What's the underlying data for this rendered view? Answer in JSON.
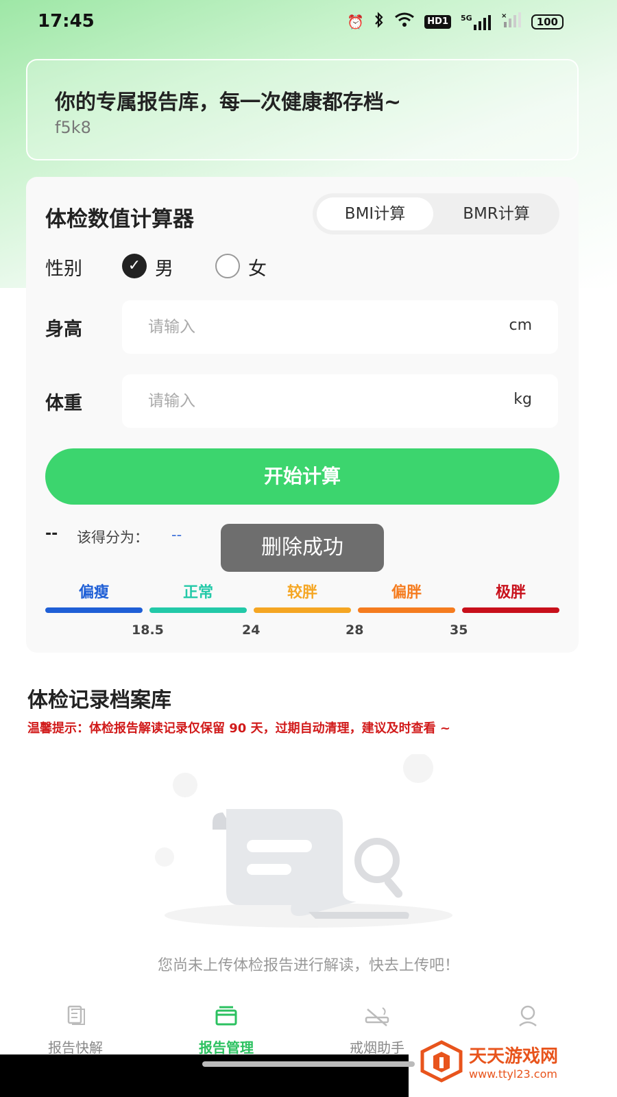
{
  "status_bar": {
    "time": "17:45",
    "network": "5G",
    "hd_badge": "HD1",
    "battery": "100"
  },
  "banner": {
    "title": "你的专属报告库，每一次健康都存档~",
    "subtitle": "f5k8"
  },
  "calculator": {
    "title": "体检数值计算器",
    "tabs": [
      {
        "label": "BMI计算",
        "active": true
      },
      {
        "label": "BMR计算",
        "active": false
      }
    ],
    "gender_label": "性别",
    "gender_options": [
      {
        "label": "男",
        "checked": true
      },
      {
        "label": "女",
        "checked": false
      }
    ],
    "height": {
      "label": "身高",
      "placeholder": "请输入",
      "unit": "cm"
    },
    "weight": {
      "label": "体重",
      "placeholder": "请输入",
      "unit": "kg"
    },
    "calc_button": "开始计算",
    "score_prefix": "--",
    "score_label": "该得分为：",
    "score_value": "--",
    "categories": [
      {
        "label": "偏瘦",
        "color": "#1f5fd6"
      },
      {
        "label": "正常",
        "color": "#23c9a8"
      },
      {
        "label": "较胖",
        "color": "#f5a623"
      },
      {
        "label": "偏胖",
        "color": "#f57c1f"
      },
      {
        "label": "极胖",
        "color": "#c8101b"
      }
    ],
    "ticks": [
      "18.5",
      "24",
      "28",
      "35"
    ]
  },
  "toast": "删除成功",
  "records": {
    "title": "体检记录档案库",
    "tip": "温馨提示：体检报告解读记录仅保留 90 天，过期自动清理，建议及时查看 ~",
    "empty_text": "您尚未上传体检报告进行解读，快去上传吧！"
  },
  "nav": [
    {
      "label": "报告快解",
      "icon": "report-icon",
      "active": false
    },
    {
      "label": "报告管理",
      "icon": "folder-icon",
      "active": true
    },
    {
      "label": "戒烟助手",
      "icon": "no-smoking-icon",
      "active": false
    },
    {
      "label": "",
      "icon": "profile-icon",
      "active": false
    }
  ],
  "watermark": {
    "name": "天天游戏网",
    "url": "www.ttyl23.com"
  }
}
